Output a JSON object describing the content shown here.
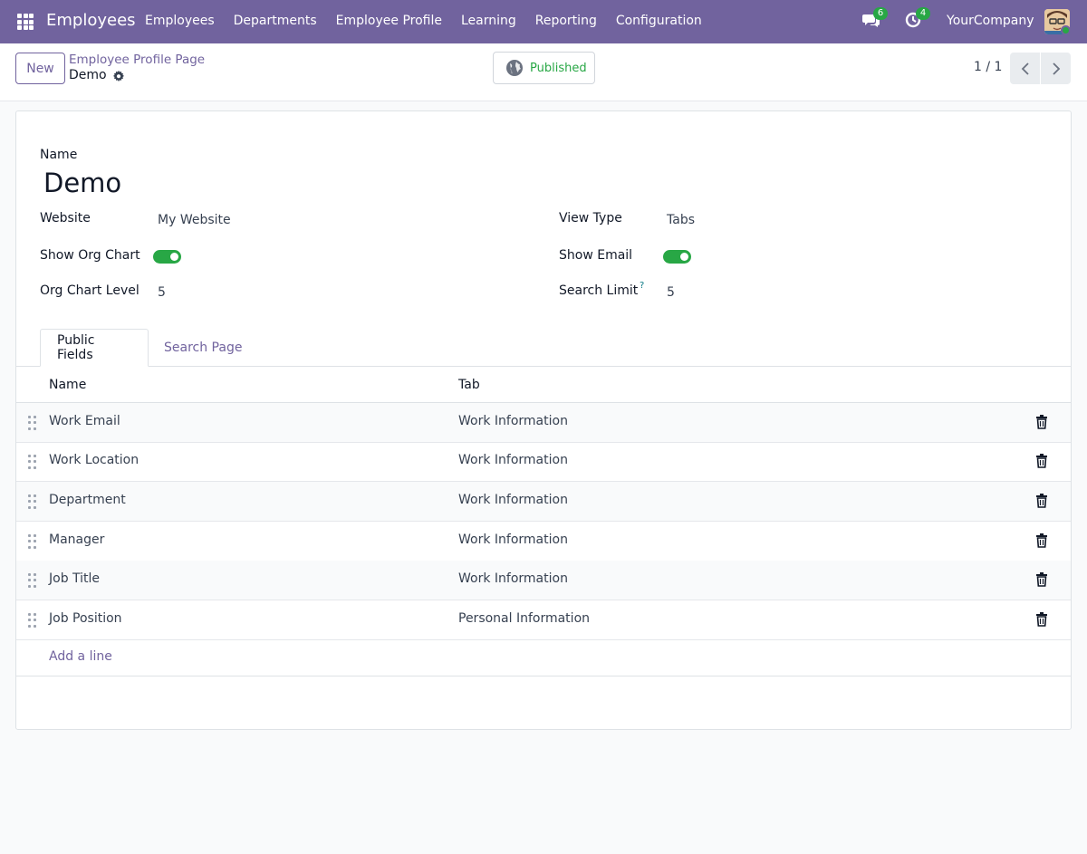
{
  "navbar": {
    "brand": "Employees",
    "menu": [
      "Employees",
      "Departments",
      "Employee Profile",
      "Learning",
      "Reporting",
      "Configuration"
    ],
    "messages_count": "6",
    "activities_count": "4",
    "company": "YourCompany",
    "bg_color": "#71639e"
  },
  "control": {
    "new_label": "New",
    "breadcrumb_parent": "Employee Profile Page",
    "breadcrumb_current": "Demo",
    "published_label": "Published",
    "pager": "1 / 1"
  },
  "form": {
    "name_label": "Name",
    "name_value": "Demo",
    "website_label": "Website",
    "website_value": "My Website",
    "view_type_label": "View Type",
    "view_type_value": "Tabs",
    "show_org_chart_label": "Show Org Chart",
    "show_org_chart": true,
    "show_email_label": "Show Email",
    "show_email": true,
    "org_chart_level_label": "Org Chart Level",
    "org_chart_level_value": "5",
    "search_limit_label": "Search Limit",
    "search_limit_help": "?",
    "search_limit_value": "5"
  },
  "tabs": [
    "Public Fields",
    "Search Page"
  ],
  "table": {
    "headers": [
      "Name",
      "Tab"
    ],
    "rows": [
      {
        "name": "Work Email",
        "tab": "Work Information"
      },
      {
        "name": "Work Location",
        "tab": "Work Information"
      },
      {
        "name": "Department",
        "tab": "Work Information"
      },
      {
        "name": "Manager",
        "tab": "Work Information"
      },
      {
        "name": "Job Title",
        "tab": "Work Information"
      },
      {
        "name": "Job Position",
        "tab": "Personal Information"
      }
    ],
    "add_line": "Add a line"
  },
  "colors": {
    "accent": "#71639e",
    "success": "#28a745"
  }
}
